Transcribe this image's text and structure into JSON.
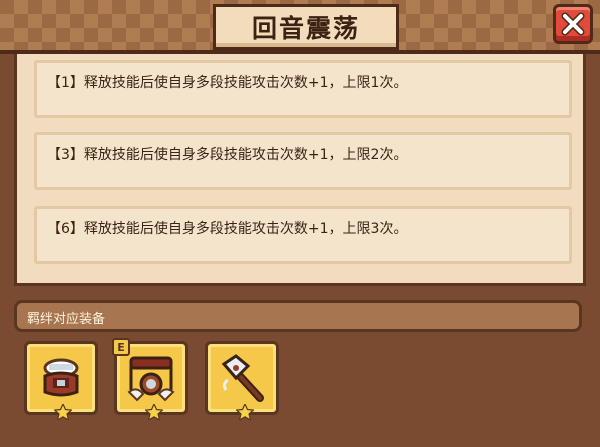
{
  "dialog": {
    "title": "回音震荡",
    "close_icon": "close-x-icon"
  },
  "effects": [
    {
      "text": "【1】释放技能后使自身多段技能攻击次数+1，上限1次。"
    },
    {
      "text": "【3】释放技能后使自身多段技能攻击次数+1，上限2次。"
    },
    {
      "text": "【6】释放技能后使自身多段技能攻击次数+1，上限3次。"
    }
  ],
  "bond": {
    "label": "羁绊对应装备",
    "items": [
      {
        "icon": "helmet-icon",
        "stars": 1
      },
      {
        "icon": "belt-icon",
        "stars": 1,
        "badge": "E"
      },
      {
        "icon": "hammer-icon",
        "stars": 1
      }
    ]
  },
  "colors": {
    "header_bg": "#9b6a44",
    "panel_bg": "#f1dcc0",
    "close_red": "#e24b3c",
    "item_gold": "#f6c84a"
  }
}
